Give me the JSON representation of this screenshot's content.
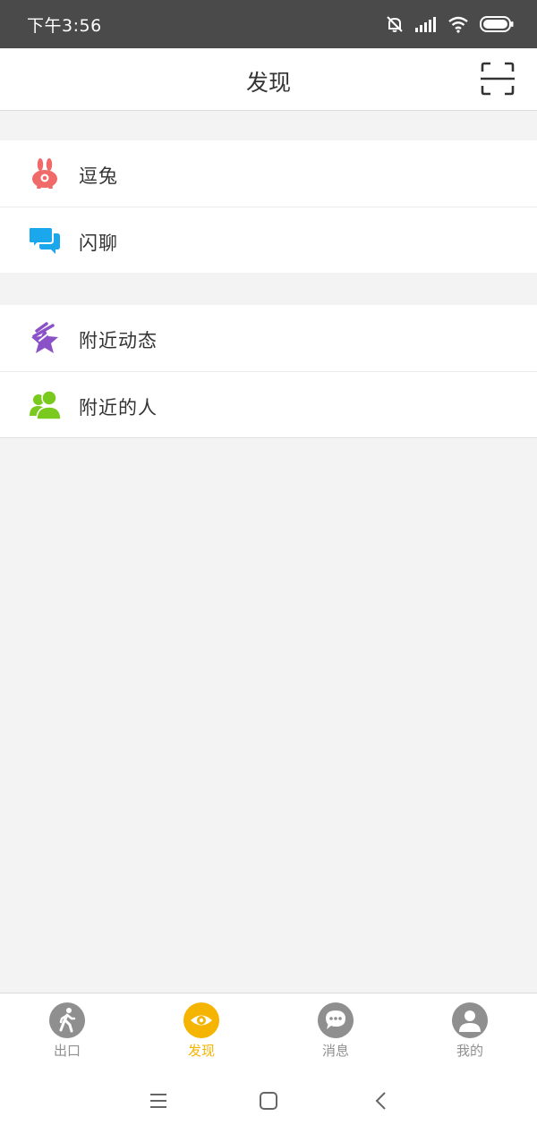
{
  "status_bar": {
    "time": "下午3:56",
    "icons": [
      "mute-bell-icon",
      "signal-icon",
      "wifi-icon",
      "battery-icon"
    ]
  },
  "header": {
    "title": "发现",
    "scan_icon": "scan-icon"
  },
  "groups": [
    {
      "items": [
        {
          "label": "逗兔",
          "icon": "rabbit-icon",
          "color": "#f06a6a"
        },
        {
          "label": "闪聊",
          "icon": "chat-bubbles-icon",
          "color": "#1aa7ec"
        }
      ]
    },
    {
      "items": [
        {
          "label": "附近动态",
          "icon": "star-icon",
          "color": "#8b52c8"
        },
        {
          "label": "附近的人",
          "icon": "people-icon",
          "color": "#7ac91e"
        }
      ]
    }
  ],
  "tabbar": {
    "active_color": "#f5b400",
    "inactive_color": "#8f8f8f",
    "tabs": [
      {
        "label": "出口",
        "icon": "walking-person-icon",
        "active": false
      },
      {
        "label": "发现",
        "icon": "eye-icon",
        "active": true
      },
      {
        "label": "消息",
        "icon": "message-icon",
        "active": false
      },
      {
        "label": "我的",
        "icon": "profile-icon",
        "active": false
      }
    ]
  },
  "system_nav": {
    "buttons": [
      "menu-icon",
      "home-icon",
      "back-icon"
    ]
  }
}
